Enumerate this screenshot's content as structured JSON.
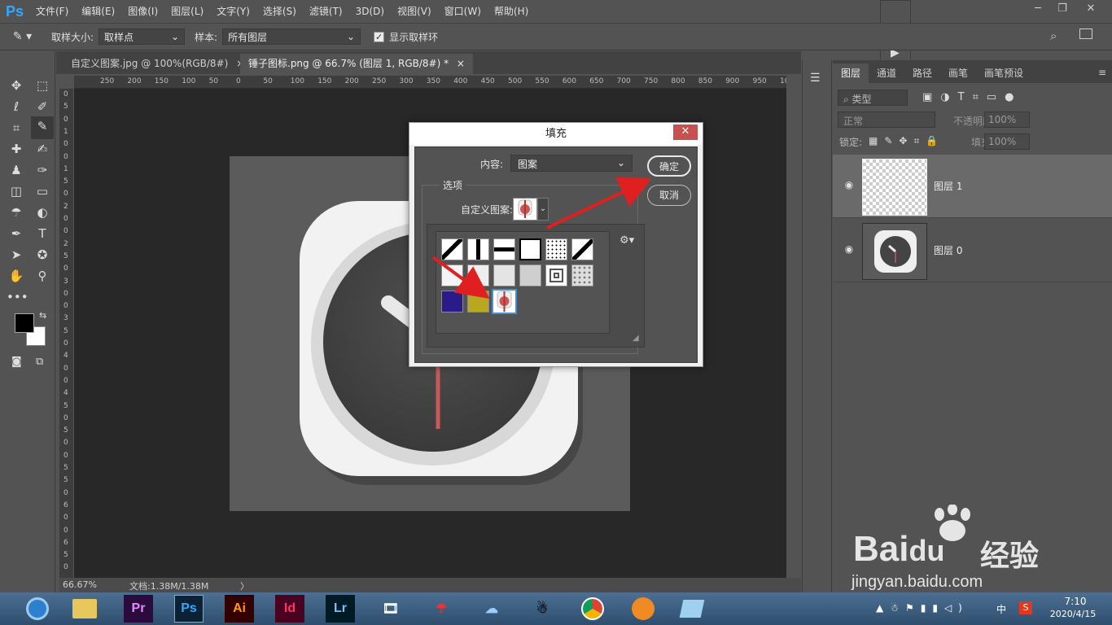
{
  "app": {
    "logo": "Ps"
  },
  "menu": [
    "文件(F)",
    "编辑(E)",
    "图像(I)",
    "图层(L)",
    "文字(Y)",
    "选择(S)",
    "滤镜(T)",
    "3D(D)",
    "视图(V)",
    "窗口(W)",
    "帮助(H)"
  ],
  "window_controls": {
    "minimize": "─",
    "restore": "❐",
    "close": "✕"
  },
  "options": {
    "sample_size_label": "取样大小:",
    "sample_size_value": "取样点",
    "sample_label": "样本:",
    "sample_value": "所有图层",
    "show_ring_label": "显示取样环",
    "show_ring_checked": true
  },
  "tabs": [
    {
      "label": "自定义图案.jpg @ 100%(RGB/8#)",
      "close": "×"
    },
    {
      "label": "锤子图标.png @ 66.7% (图层 1, RGB/8#) *",
      "close": "×"
    }
  ],
  "ruler": {
    "top_ticks": [
      "250",
      "200",
      "150",
      "100",
      "50",
      "0",
      "50",
      "100",
      "150",
      "200",
      "250",
      "300",
      "350",
      "400",
      "450",
      "500",
      "550",
      "600",
      "650",
      "700",
      "750",
      "800",
      "850",
      "900",
      "950",
      "100"
    ],
    "left_ticks": [
      "0",
      "5",
      "0",
      "1",
      "0",
      "0",
      "1",
      "5",
      "0",
      "2",
      "0",
      "0",
      "2",
      "5",
      "0",
      "3",
      "0",
      "0",
      "3",
      "5",
      "0",
      "4",
      "0",
      "0",
      "4",
      "5",
      "0",
      "5",
      "0",
      "0",
      "5",
      "5",
      "0",
      "6",
      "0",
      "0",
      "6",
      "5",
      "0"
    ]
  },
  "status": {
    "zoom": "66.67%",
    "doc_info": "文档:1.38M/1.38M",
    "arrow": "〉"
  },
  "fill_dialog": {
    "title": "填充",
    "close": "✕",
    "content_label": "内容:",
    "content_value": "图案",
    "options_group": "选项",
    "custom_pattern_label": "自定义图案:",
    "ok": "确定",
    "cancel": "取消"
  },
  "layers_panel": {
    "tabs": [
      "图层",
      "通道",
      "路径",
      "画笔",
      "画笔预设"
    ],
    "filter_label": "类型",
    "blend_mode": "正常",
    "opacity_label": "不透明度:",
    "opacity_value": "100%",
    "lock_label": "锁定:",
    "fill_label": "填充:",
    "fill_value": "100%",
    "layers": [
      {
        "name": "图层 1",
        "selected": true
      },
      {
        "name": "图层 0",
        "selected": false
      }
    ]
  },
  "taskbar": {
    "apps": [
      "Pr",
      "Ps",
      "Ai",
      "Id",
      "Lr"
    ],
    "time": "7:10",
    "date": "2020/4/15",
    "ime": "中"
  },
  "watermark": {
    "brand": "Bai",
    "brand_du": "du",
    "cn": "经验",
    "url": "jingyan.baidu.com"
  },
  "colors": {
    "accent_ps": "#31a8ff",
    "panel": "#535353",
    "canvas_bg": "#282828",
    "arrow": "#e02020",
    "close_red": "#c75050"
  }
}
